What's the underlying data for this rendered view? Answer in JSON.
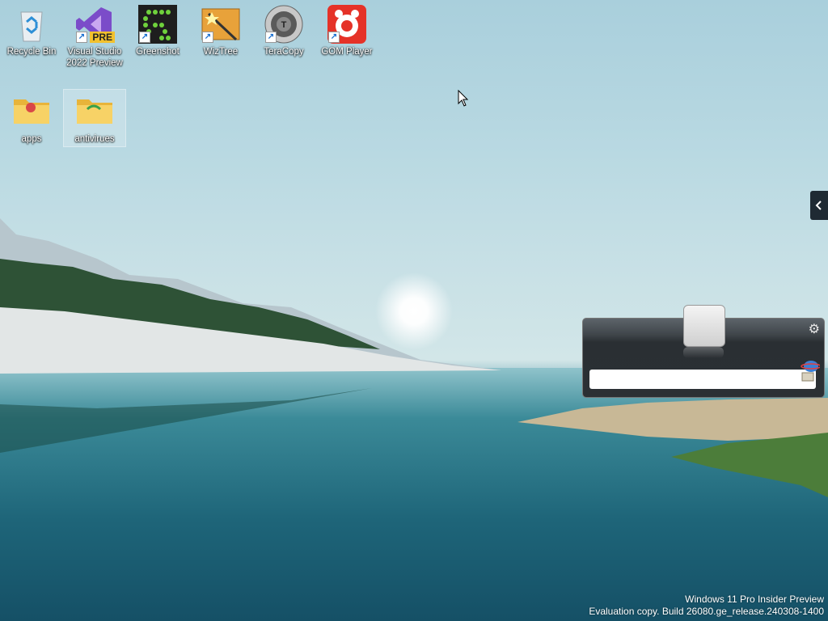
{
  "desktop": {
    "icons": [
      {
        "label": "Recycle Bin",
        "icon": "recycle-bin-icon"
      },
      {
        "label": "Visual Studio\n2022 Preview",
        "icon": "visual-studio-icon",
        "badge": "PRE"
      },
      {
        "label": "Greenshot",
        "icon": "greenshot-icon"
      },
      {
        "label": "WizTree",
        "icon": "wiztree-icon"
      },
      {
        "label": "TeraCopy",
        "icon": "teracopy-icon"
      },
      {
        "label": "GOM Player",
        "icon": "gom-player-icon"
      },
      {
        "label": "apps",
        "icon": "folder-icon"
      },
      {
        "label": "antivirues",
        "icon": "folder-icon"
      }
    ]
  },
  "gadget": {
    "search_value": "",
    "settings_icon": "gear-icon",
    "globe_icon": "globe-icon"
  },
  "watermark": {
    "line1": "Windows 11 Pro Insider Preview",
    "line2": "Evaluation copy. Build 26080.ge_release.240308-1400"
  },
  "colors": {
    "sky": "#b9d9e2",
    "water": "#1d6377",
    "gadget_dark": "#2b3034"
  }
}
